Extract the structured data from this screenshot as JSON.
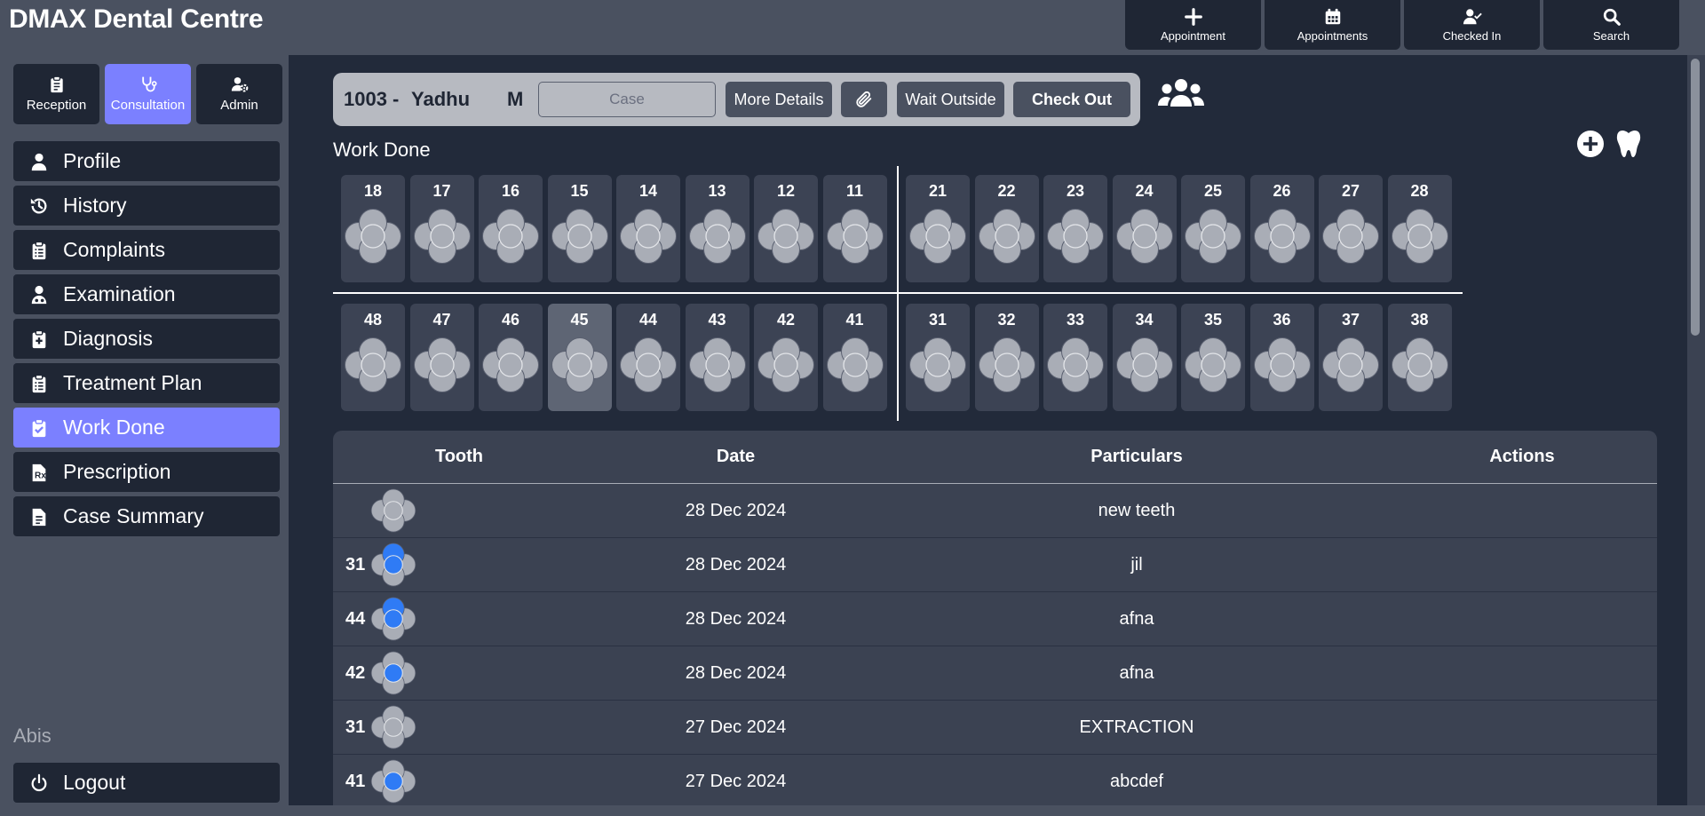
{
  "app": {
    "title": "DMAX Dental Centre"
  },
  "topnav": [
    {
      "label": "Appointment",
      "icon": "plus-icon"
    },
    {
      "label": "Appointments",
      "icon": "calendar-icon"
    },
    {
      "label": "Checked In",
      "icon": "user-check-icon"
    },
    {
      "label": "Search",
      "icon": "search-icon"
    }
  ],
  "modes": [
    {
      "label": "Reception",
      "icon": "clipboard-icon",
      "active": false
    },
    {
      "label": "Consultation",
      "icon": "stethoscope-icon",
      "active": true
    },
    {
      "label": "Admin",
      "icon": "user-gear-icon",
      "active": false
    }
  ],
  "menu": [
    {
      "label": "Profile",
      "icon": "user-icon",
      "active": false
    },
    {
      "label": "History",
      "icon": "history-icon",
      "active": false
    },
    {
      "label": "Complaints",
      "icon": "clipboard-list-icon",
      "active": false
    },
    {
      "label": "Examination",
      "icon": "doctor-icon",
      "active": false
    },
    {
      "label": "Diagnosis",
      "icon": "file-medical-icon",
      "active": false
    },
    {
      "label": "Treatment Plan",
      "icon": "clipboard-list-icon",
      "active": false
    },
    {
      "label": "Work Done",
      "icon": "clipboard-check-icon",
      "active": true
    },
    {
      "label": "Prescription",
      "icon": "prescription-icon",
      "active": false
    },
    {
      "label": "Case Summary",
      "icon": "file-icon",
      "active": false
    }
  ],
  "user": {
    "name": "Abis"
  },
  "logout": {
    "label": "Logout"
  },
  "patient": {
    "id": "1003 -",
    "name": "Yadhu",
    "sex": "M",
    "case_placeholder": "Case",
    "more_details": "More Details",
    "wait_outside": "Wait Outside",
    "check_out": "Check Out"
  },
  "section": {
    "title": "Work Done"
  },
  "teeth": {
    "upper_right": [
      "18",
      "17",
      "16",
      "15",
      "14",
      "13",
      "12",
      "11"
    ],
    "upper_left": [
      "21",
      "22",
      "23",
      "24",
      "25",
      "26",
      "27",
      "28"
    ],
    "lower_right": [
      "48",
      "47",
      "46",
      "45",
      "44",
      "43",
      "42",
      "41"
    ],
    "lower_left": [
      "31",
      "32",
      "33",
      "34",
      "35",
      "36",
      "37",
      "38"
    ],
    "selected": "45"
  },
  "table": {
    "headers": [
      "Tooth",
      "Date",
      "Particulars",
      "Actions"
    ],
    "rows": [
      {
        "tooth": "",
        "marked": [],
        "date": "28 Dec 2024",
        "particulars": "new teeth"
      },
      {
        "tooth": "31",
        "marked": [
          "center",
          "top"
        ],
        "date": "28 Dec 2024",
        "particulars": "jil"
      },
      {
        "tooth": "44",
        "marked": [
          "center",
          "top"
        ],
        "date": "28 Dec 2024",
        "particulars": "afna"
      },
      {
        "tooth": "42",
        "marked": [
          "center"
        ],
        "date": "28 Dec 2024",
        "particulars": "afna"
      },
      {
        "tooth": "31",
        "marked": [],
        "date": "27 Dec 2024",
        "particulars": "EXTRACTION"
      },
      {
        "tooth": "41",
        "marked": [
          "center"
        ],
        "date": "27 Dec 2024",
        "particulars": "abcdef"
      }
    ]
  },
  "colors": {
    "accent": "#7b80ff",
    "panel": "#1f2634",
    "surface": "#3b4252",
    "mark": "#2f7bf5",
    "tooth": "#a9adb6"
  }
}
